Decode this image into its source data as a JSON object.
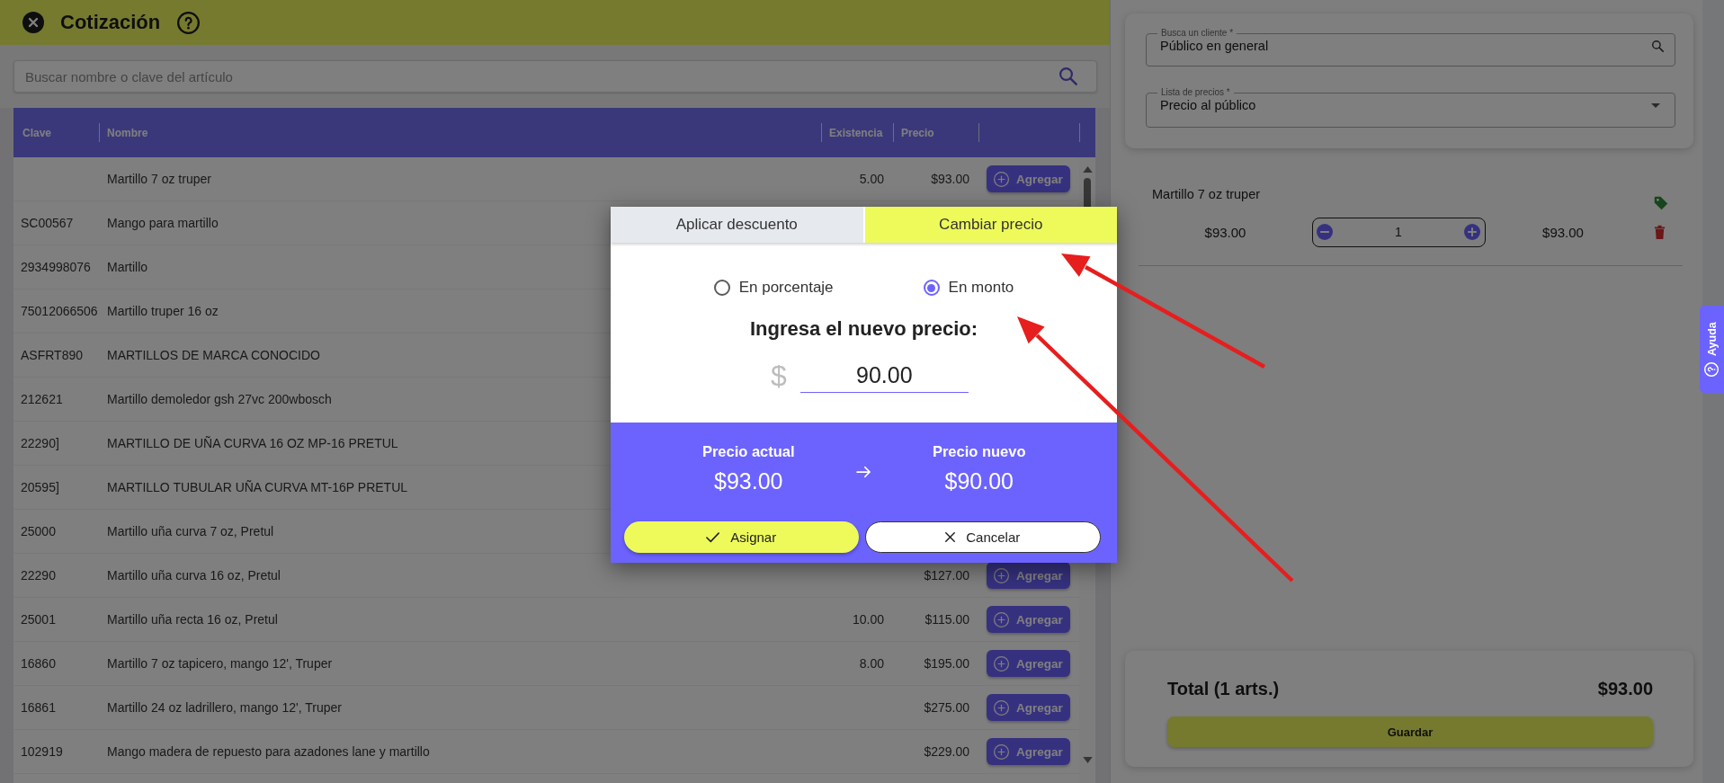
{
  "header": {
    "title": "Cotización"
  },
  "search": {
    "placeholder": "Buscar nombre o clave del artículo"
  },
  "table": {
    "columns": [
      "Clave",
      "Nombre",
      "Existencia",
      "Precio"
    ],
    "rows": [
      {
        "nombre": "Martillo 7 oz truper",
        "existencia": "5.00",
        "precio": "$93.00",
        "action": "Agregar"
      },
      {
        "clave": "SC00567",
        "nombre": "Mango para martillo"
      },
      {
        "clave": "2934998076",
        "nombre": "Martillo"
      },
      {
        "clave": "75012066506",
        "nombre": "Martillo truper 16 oz"
      },
      {
        "clave": "ASFRT890",
        "nombre": "MARTILLOS DE MARCA CONOCIDO"
      },
      {
        "clave": "212621",
        "nombre": "Martillo demoledor gsh 27vc 200wbosch"
      },
      {
        "clave": "22290]",
        "nombre": "MARTILLO DE UÑA CURVA 16 OZ MP-16 PRETUL"
      },
      {
        "clave": "20595]",
        "nombre": "MARTILLO TUBULAR UÑA CURVA MT-16P PRETUL"
      },
      {
        "clave": "25000",
        "nombre": "Martillo uña curva 7 oz, Pretul"
      },
      {
        "clave": "22290",
        "nombre": "Martillo uña curva 16 oz, Pretul",
        "precio": "$127.00",
        "action": "Agregar"
      },
      {
        "clave": "25001",
        "nombre": "Martillo uña recta 16 oz, Pretul",
        "existencia": "10.00",
        "precio": "$115.00",
        "action": "Agregar"
      },
      {
        "clave": "16860",
        "nombre": "Martillo 7 oz tapicero, mango 12', Truper",
        "existencia": "8.00",
        "precio": "$195.00",
        "action": "Agregar"
      },
      {
        "clave": "16861",
        "nombre": "Martillo 24 oz ladrillero, mango 12', Truper",
        "precio": "$275.00",
        "action": "Agregar"
      },
      {
        "clave": "102919",
        "nombre": "Mango madera de repuesto para azadones lane y martillo",
        "precio": "$229.00",
        "action": "Agregar"
      }
    ]
  },
  "customer_card": {
    "fields": [
      {
        "kind": "search",
        "label": "Busca un cliente *",
        "value": "Público en general"
      },
      {
        "kind": "select",
        "label": "Lista de precios *",
        "value": "Precio al público"
      }
    ]
  },
  "cart": {
    "items": [
      {
        "name": "Martillo 7 oz truper",
        "unit_price": "$93.00",
        "quantity": "1",
        "subtotal": "$93.00"
      }
    ]
  },
  "total_card": {
    "label": "Total (1 arts.)",
    "amount": "$93.00",
    "button": "Guardar"
  },
  "help_tab": {
    "label": "Ayuda"
  },
  "dialog": {
    "tabs": [
      {
        "label": "Aplicar descuento",
        "selected": false
      },
      {
        "label": "Cambiar precio",
        "selected": true
      }
    ],
    "options": [
      {
        "label": "En porcentaje",
        "selected": false
      },
      {
        "label": "En monto",
        "selected": true
      }
    ],
    "prompt": "Ingresa el nuevo precio:",
    "currency_symbol": "$",
    "value": "90.00",
    "summary": [
      {
        "label": "Precio actual",
        "value": "$93.00"
      },
      {
        "label": "Precio nuevo",
        "value": "$90.00"
      }
    ],
    "buttons": [
      {
        "kind": "confirm",
        "label": "Asignar"
      },
      {
        "kind": "cancel",
        "label": "Cancelar"
      }
    ]
  }
}
